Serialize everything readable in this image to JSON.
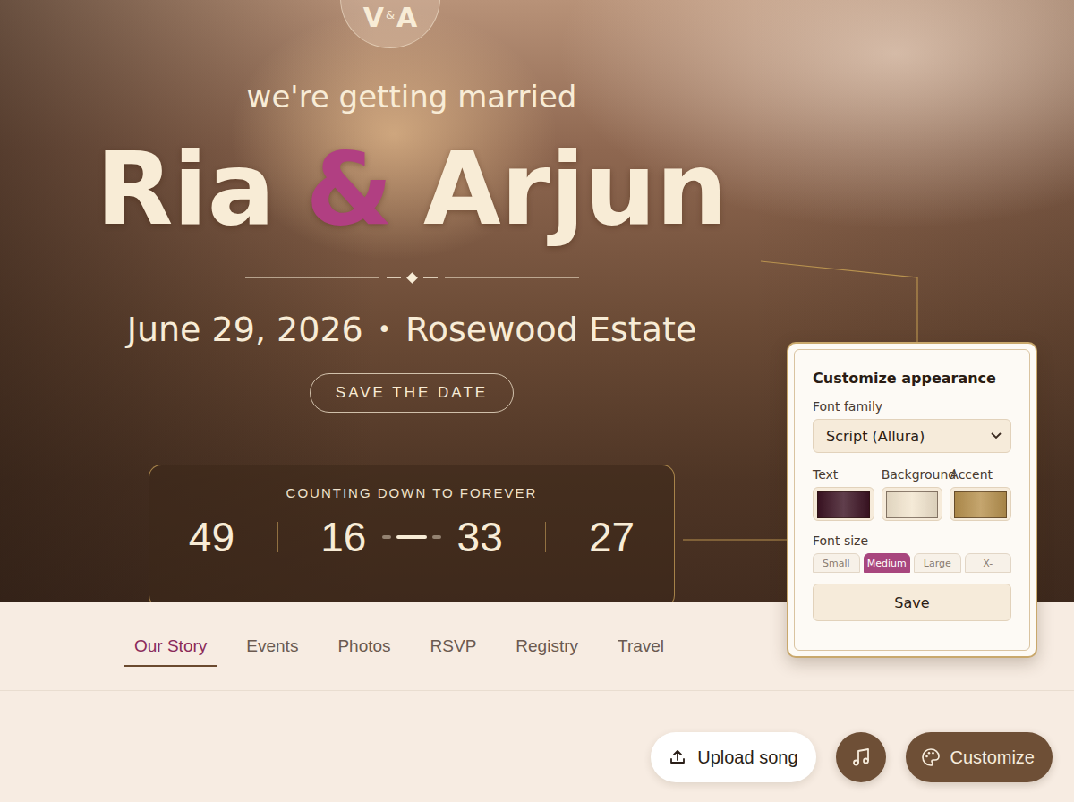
{
  "monogram": {
    "left": "V",
    "amp": "&",
    "right": "A"
  },
  "hero": {
    "kicker": "we're getting married",
    "name_left": "Ria",
    "amp": "&",
    "name_right": "Arjun",
    "date": "June 29, 2026",
    "separator": "•",
    "venue": "Rosewood Estate",
    "cta": "SAVE THE DATE"
  },
  "countdown": {
    "title": "COUNTING DOWN TO FOREVER",
    "values": [
      "49",
      "16",
      "33",
      "27"
    ]
  },
  "customize_panel": {
    "title": "Customize appearance",
    "font_family_label": "Font family",
    "font_family_value": "Script (Allura)",
    "colors": [
      {
        "label": "Text",
        "color": "#3d1424"
      },
      {
        "label": "Background",
        "color": "#f3e6cf"
      },
      {
        "label": "Accent",
        "color": "#b8924f"
      }
    ],
    "font_size_label": "Font size",
    "font_sizes": [
      {
        "label": "Small",
        "selected": false
      },
      {
        "label": "Medium",
        "selected": true
      },
      {
        "label": "Large",
        "selected": false
      },
      {
        "label": "X-",
        "selected": false
      }
    ],
    "save": "Save"
  },
  "tabs": [
    {
      "label": "Our Story",
      "selected": true
    },
    {
      "label": "Events",
      "selected": false
    },
    {
      "label": "Photos",
      "selected": false
    },
    {
      "label": "RSVP",
      "selected": false
    },
    {
      "label": "Registry",
      "selected": false
    },
    {
      "label": "Travel",
      "selected": false
    }
  ],
  "actions": {
    "upload": "Upload song",
    "customize": "Customize"
  }
}
